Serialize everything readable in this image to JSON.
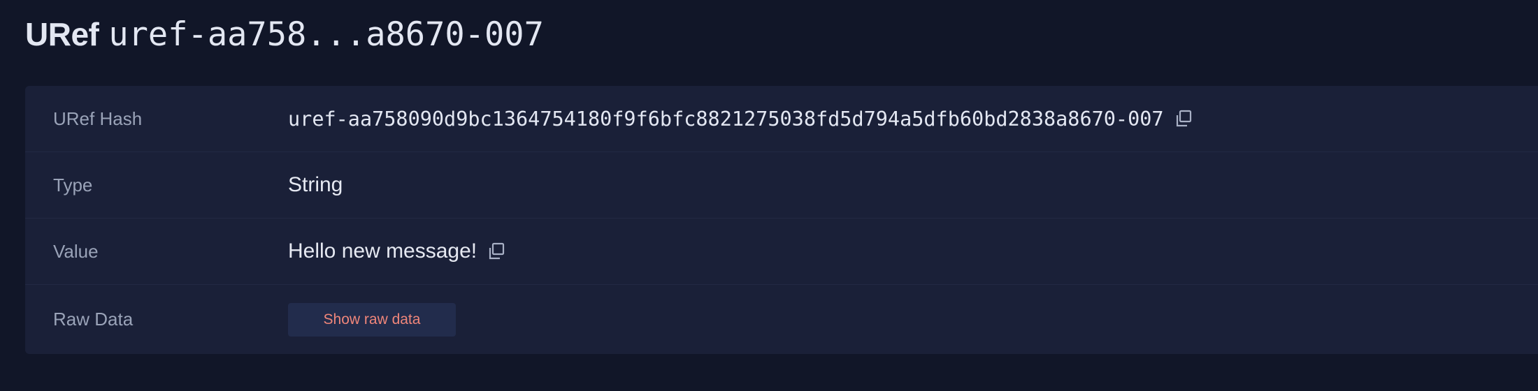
{
  "header": {
    "title_prefix": "URef",
    "title_id": "uref-aa758...a8670-007"
  },
  "details": {
    "uref_hash": {
      "label": "URef Hash",
      "value": "uref-aa758090d9bc1364754180f9f6bfc8821275038fd5d794a5dfb60bd2838a8670-007",
      "icon": "copy-icon"
    },
    "type": {
      "label": "Type",
      "value": "String"
    },
    "value": {
      "label": "Value",
      "value": "Hello new message!",
      "icon": "copy-icon"
    },
    "raw_data": {
      "label": "Raw Data",
      "button_label": "Show raw data"
    }
  },
  "colors": {
    "background": "#111628",
    "card": "#1a2038",
    "label": "#9aa3b8",
    "text": "#e6e9f2",
    "button_bg": "#222c4c",
    "button_text": "#f0867a"
  }
}
